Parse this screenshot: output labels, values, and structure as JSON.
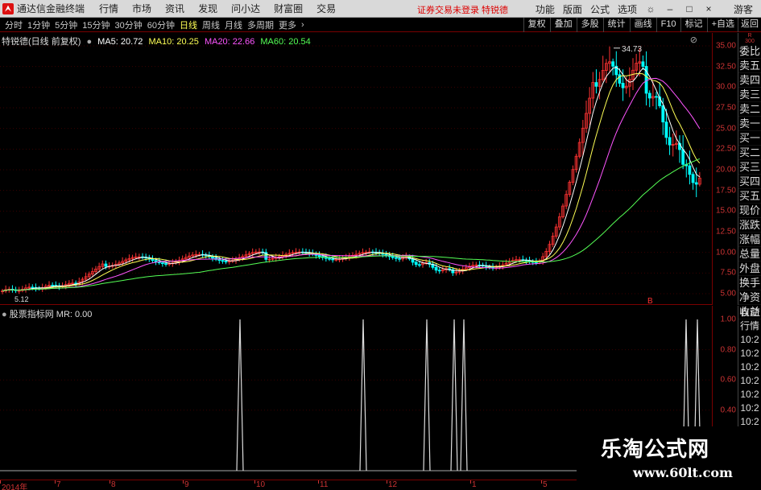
{
  "menubar": {
    "app_title": "通达信金融终端",
    "items": [
      "行情",
      "市场",
      "资讯",
      "发现",
      "问小达",
      "财富圈",
      "交易"
    ],
    "center_text": "证券交易未登录  特锐德",
    "right_items": [
      "功能",
      "版面",
      "公式",
      "选项"
    ],
    "guest": "游客"
  },
  "toolbar": {
    "periods": [
      "分时",
      "1分钟",
      "5分钟",
      "15分钟",
      "30分钟",
      "60分钟",
      "日线",
      "周线",
      "月线",
      "多周期",
      "更多"
    ],
    "active_period": "日线",
    "tools": [
      "复权",
      "叠加",
      "多股",
      "统计",
      "画线",
      "F10",
      "标记",
      "+自选",
      "返回"
    ]
  },
  "main_chart": {
    "stock_label": "特锐德(日线 前复权)",
    "ma5": "MA5: 20.72",
    "ma10": "MA10: 20.25",
    "ma20": "MA20: 22.66",
    "ma60": "MA60: 20.54",
    "peak_label": "34.73",
    "low_label": "5.12",
    "b_marker": "B",
    "y_ticks": [
      "35.00",
      "32.50",
      "30.00",
      "27.50",
      "25.00",
      "22.50",
      "20.00",
      "17.50",
      "15.00",
      "12.50",
      "10.00",
      "7.50",
      "5.00"
    ]
  },
  "orderbook": {
    "top_label": "R\n300",
    "items": [
      "委比",
      "卖五",
      "卖四",
      "卖三",
      "卖二",
      "卖一",
      "买一",
      "买二",
      "买三",
      "买四",
      "买五",
      "现价",
      "涨跌",
      "涨幅",
      "总量",
      "外盘",
      "换手",
      "净资",
      "收益"
    ]
  },
  "indicator": {
    "header": "股票指标网  MR: 0.00",
    "y_ticks": [
      "1.00",
      "0.80",
      "0.60",
      "0.40"
    ],
    "side_items": [
      "自动",
      "行情",
      "10:2",
      "10:2",
      "10:2",
      "10:2",
      "10:2",
      "10:2",
      "10:2",
      "10:2"
    ]
  },
  "date_axis": [
    "2014年",
    "7",
    "8",
    "9",
    "10",
    "11",
    "12",
    "1",
    "5"
  ],
  "watermark": {
    "title": "乐淘公式网",
    "url": "www.60lt.com"
  },
  "colors": {
    "up": "#ff3333",
    "down": "#00ffff",
    "ma5": "#ffffff",
    "ma10": "#ffff55",
    "ma20": "#ff55ff",
    "ma60": "#55ff55"
  }
}
